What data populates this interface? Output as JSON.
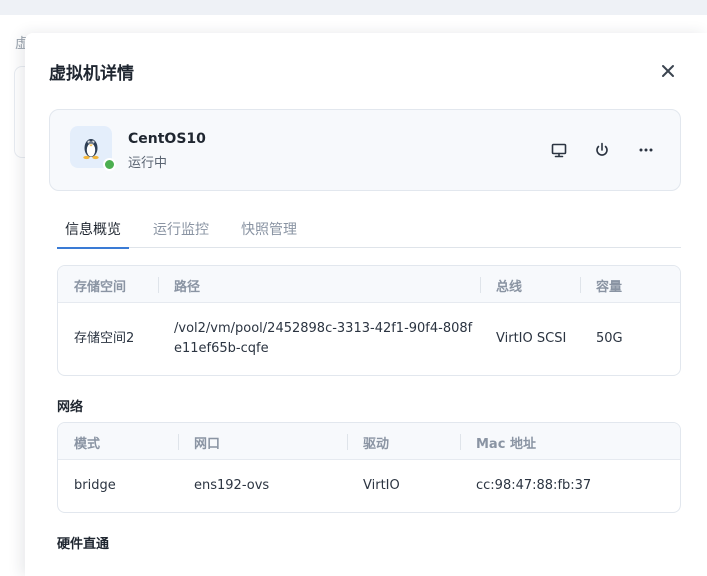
{
  "background": {
    "title_fragment": "虚"
  },
  "modal": {
    "title": "虚拟机详情"
  },
  "vm": {
    "name": "CentOS10",
    "status": "运行中",
    "status_color": "#4caf50",
    "os_icon": "linux-tux-icon",
    "actions": [
      {
        "name": "console",
        "icon": "monitor-icon"
      },
      {
        "name": "power",
        "icon": "power-icon"
      },
      {
        "name": "more",
        "icon": "more-horizontal-icon"
      }
    ]
  },
  "tabs": [
    {
      "label": "信息概览",
      "active": true
    },
    {
      "label": "运行监控",
      "active": false
    },
    {
      "label": "快照管理",
      "active": false
    }
  ],
  "storage": {
    "columns": [
      "存储空间",
      "路径",
      "总线",
      "容量"
    ],
    "rows": [
      {
        "space": "存储空间2",
        "path": "/vol2/vm/pool/2452898c-3313-42f1-90f4-808fe11ef65b-cqfe",
        "bus": "VirtIO SCSI",
        "capacity": "50G"
      }
    ]
  },
  "network": {
    "title": "网络",
    "columns": [
      "模式",
      "网口",
      "驱动",
      "Mac 地址"
    ],
    "rows": [
      {
        "mode": "bridge",
        "port": "ens192-ovs",
        "driver": "VirtIO",
        "mac": "cc:98:47:88:fb:37"
      }
    ]
  },
  "passthrough": {
    "title": "硬件直通"
  },
  "colors": {
    "accent": "#3a7bd5",
    "running": "#4caf50"
  }
}
